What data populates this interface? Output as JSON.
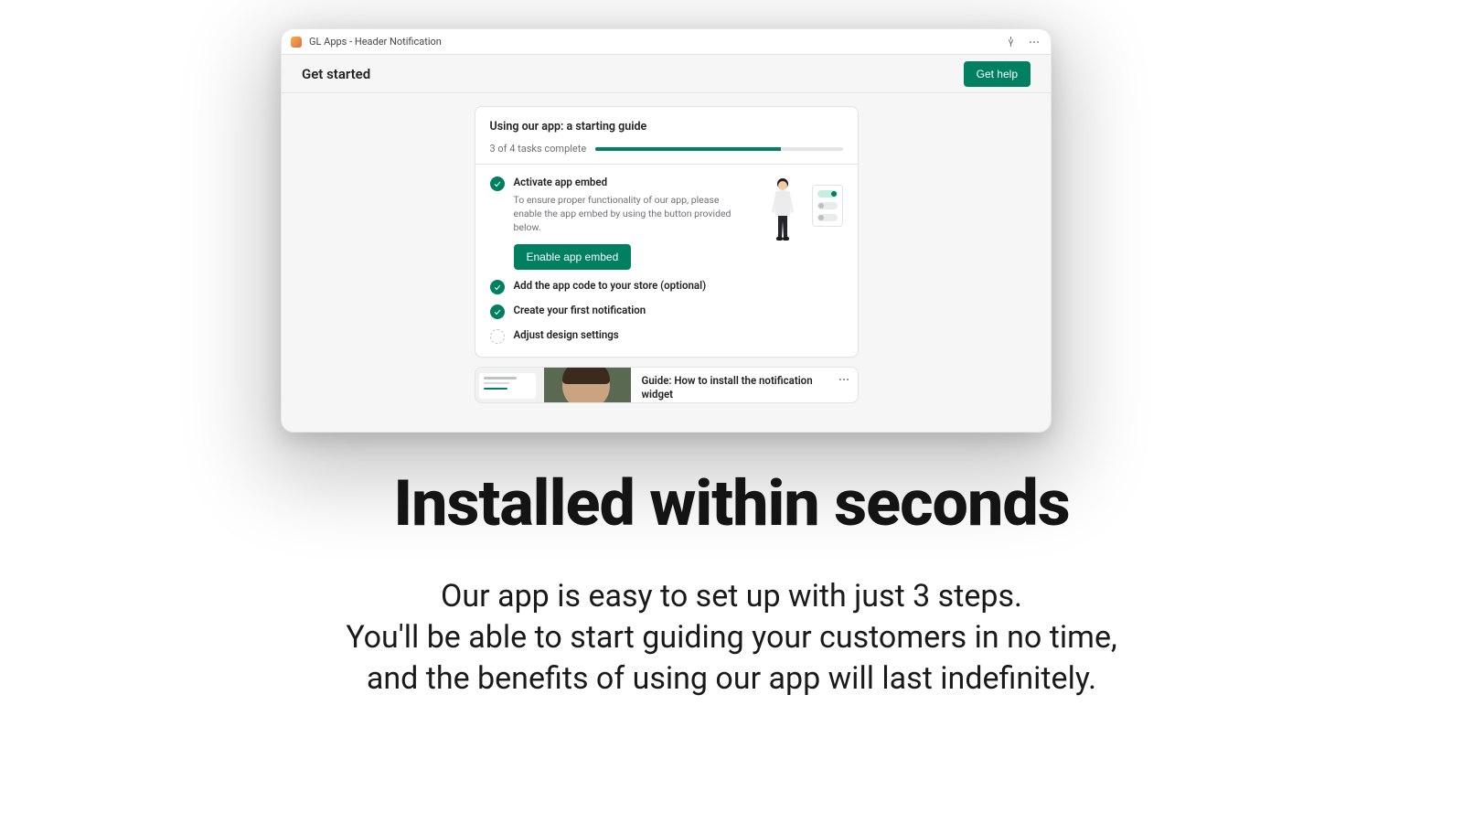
{
  "window": {
    "title": "GL Apps - Header Notification"
  },
  "header": {
    "title": "Get started",
    "help_button": "Get help"
  },
  "guide_card": {
    "title": "Using our app: a starting guide",
    "progress_label": "3 of 4 tasks complete",
    "progress_pct": 75
  },
  "tasks": [
    {
      "done": true,
      "title": "Activate app embed",
      "desc": "To ensure proper functionality of our app, please enable the app embed by using the button provided below.",
      "action": "Enable app embed",
      "expanded": true
    },
    {
      "done": true,
      "title": "Add the app code to your store (optional)"
    },
    {
      "done": true,
      "title": "Create your first notification"
    },
    {
      "done": false,
      "title": "Adjust design settings"
    }
  ],
  "secondary_card": {
    "title": "Guide: How to install the notification widget"
  },
  "hero": {
    "title": "Installed within seconds",
    "line1": "Our app is easy to set up with just 3 steps.",
    "line2": "You'll be able to start guiding your customers in no time,",
    "line3": "and the benefits of using our app will last indefinitely."
  }
}
